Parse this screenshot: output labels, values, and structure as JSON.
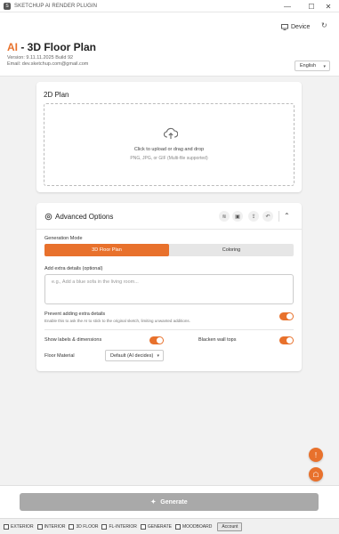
{
  "window": {
    "title": "SKETCHUP AI RENDER PLUGIN",
    "controls": [
      "—",
      "☐",
      "✕"
    ]
  },
  "header": {
    "device_label": "Device",
    "refresh_icon": "↻",
    "title_ai": "AI",
    "title_rest": " - 3D Floor Plan",
    "version": "Version: 9.11.11.2025 Build 92",
    "email": "Email: dev.sketchup.com@gmail.com",
    "language": "English"
  },
  "plan_card": {
    "title": "2D Plan",
    "drop_text": "Click to upload or drag and drop",
    "drop_hint": "PNG, JPG, or GIF (Multi-file supported)"
  },
  "advanced": {
    "title": "Advanced Options",
    "generation_mode_label": "Generation Mode",
    "modes": [
      "3D Floor Plan",
      "Coloring"
    ],
    "active_mode": "3D Floor Plan",
    "extra_details_label": "Add extra details (optional)",
    "extra_details_placeholder": "e.g., Add a blue sofa in the living room...",
    "prevent_label": "Prevent adding extra details",
    "prevent_desc": "Enable this to ask the AI to stick to the original sketch, limiting unwanted additions.",
    "prevent_on": true,
    "show_labels_label": "Show labels & dimensions",
    "show_labels_on": true,
    "blacken_label": "Blacken wall tops",
    "blacken_on": true,
    "floor_material_label": "Floor Material",
    "floor_material_value": "Default (AI decides)"
  },
  "generate": {
    "label": "Generate",
    "icon": "✦"
  },
  "footer": {
    "checkboxes": [
      "EXTERIOR",
      "INTERIOR",
      "3D FLOOR",
      "FL-INTERIOR",
      "GENERATE",
      "MOODBOARD"
    ],
    "account_label": "Account"
  },
  "colors": {
    "accent": "#e8712c",
    "disabled_button": "#a9a9a9"
  }
}
